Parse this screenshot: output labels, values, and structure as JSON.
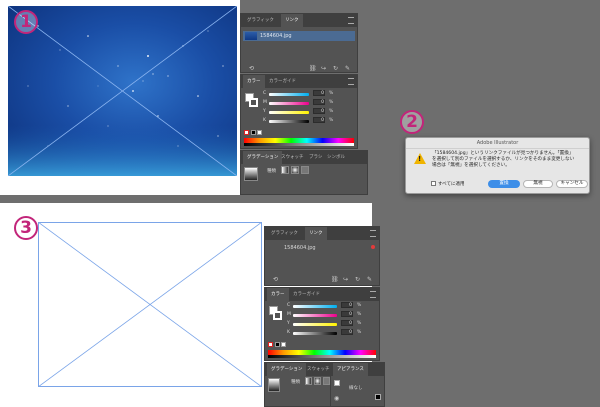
{
  "markers": {
    "one": "1",
    "two": "2",
    "three": "3"
  },
  "panel_top": {
    "tabs": [
      "グラフィック",
      "リンク"
    ],
    "link_file": "1584604.jpg",
    "color_tabs": [
      "カラー",
      "カラーガイド"
    ],
    "channels": [
      {
        "label": "C",
        "value": "0"
      },
      {
        "label": "M",
        "value": "0"
      },
      {
        "label": "Y",
        "value": "0"
      },
      {
        "label": "K",
        "value": "0"
      }
    ],
    "percent": "%",
    "bottom_tabs": [
      "グラデーション",
      "スウォッチ",
      "ブラシ",
      "シンボル"
    ],
    "type_label": "種類"
  },
  "dialog": {
    "title": "Adobe Illustrator",
    "message": "「1584604.jpg」というリンクファイルが見つかりません。「置換」\nを選択して別のファイルを選択するか、リンクをそのまま変更しない\n場合は「無視」を選択してください。",
    "apply_all": "すべてに適用",
    "replace": "置換",
    "ignore": "無視",
    "cancel": "キャンセル"
  },
  "panel_bottom": {
    "tabs": [
      "グラフィック",
      "リンク"
    ],
    "link_file": "1584604.jpg",
    "color_tabs": [
      "カラー",
      "カラーガイド"
    ],
    "channels": [
      {
        "label": "C",
        "value": "0"
      },
      {
        "label": "M",
        "value": "0"
      },
      {
        "label": "Y",
        "value": "0"
      },
      {
        "label": "K",
        "value": "0"
      }
    ],
    "percent": "%",
    "bottom_tabs": [
      "グラデーション",
      "スウォッチ"
    ],
    "type_label": "種類",
    "appearance_tab": "アピアランス",
    "appearance_item": "線なし"
  },
  "colors": {
    "accent": "#c2257a",
    "link_highlight": "#4b6b93",
    "warning": "#f0b400",
    "primary_button": "#3d8ee8"
  }
}
